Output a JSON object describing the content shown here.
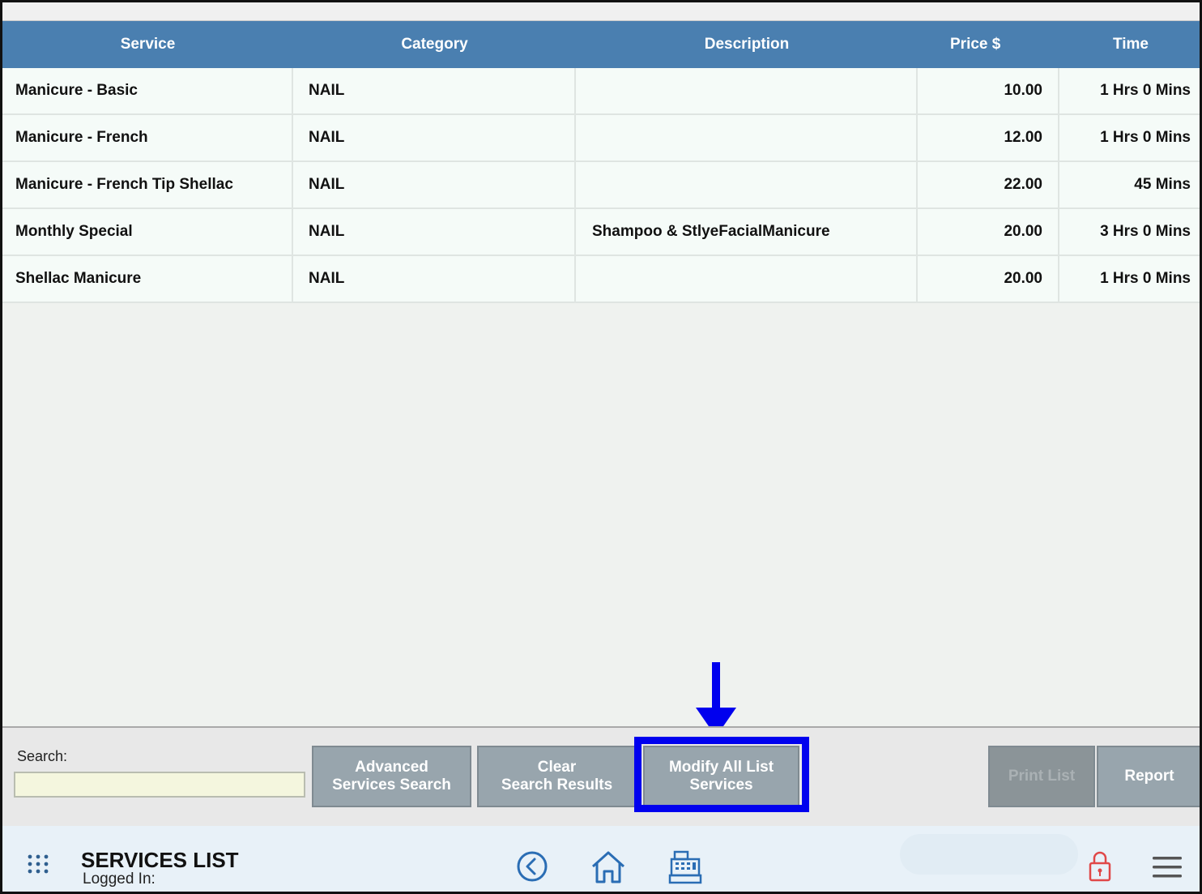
{
  "table": {
    "headers": [
      "Service",
      "Category",
      "Description",
      "Price $",
      "Time"
    ],
    "rows": [
      {
        "service": "Manicure - Basic",
        "category": "NAIL",
        "description": "",
        "price": "10.00",
        "time": "1 Hrs 0 Mins"
      },
      {
        "service": "Manicure - French",
        "category": "NAIL",
        "description": "",
        "price": "12.00",
        "time": "1 Hrs 0 Mins"
      },
      {
        "service": "Manicure - French Tip Shellac",
        "category": "NAIL",
        "description": "",
        "price": "22.00",
        "time": "45 Mins"
      },
      {
        "service": "Monthly Special",
        "category": "NAIL",
        "description": "Shampoo & StlyeFacialManicure",
        "price": "20.00",
        "time": "3 Hrs 0 Mins"
      },
      {
        "service": "Shellac Manicure",
        "category": "NAIL",
        "description": "",
        "price": "20.00",
        "time": "1 Hrs 0 Mins"
      }
    ]
  },
  "toolbar": {
    "search_label": "Search:",
    "search_value": "",
    "advanced_line1": "Advanced",
    "advanced_line2": "Services Search",
    "clear_line1": "Clear",
    "clear_line2": "Search Results",
    "modify_line1": "Modify All List",
    "modify_line2": "Services",
    "print_label": "Print List",
    "report_label": "Report"
  },
  "bottom_bar": {
    "title": "SERVICES LIST",
    "logged_in": "Logged In:",
    "icons": [
      "apps-grid-icon",
      "back-icon",
      "home-icon",
      "cash-register-icon",
      "lock-icon",
      "menu-icon"
    ]
  },
  "colors": {
    "header": "#4a7fb0",
    "button": "#98a5ad",
    "highlight": "#0000ee",
    "lock": "#e04848"
  }
}
